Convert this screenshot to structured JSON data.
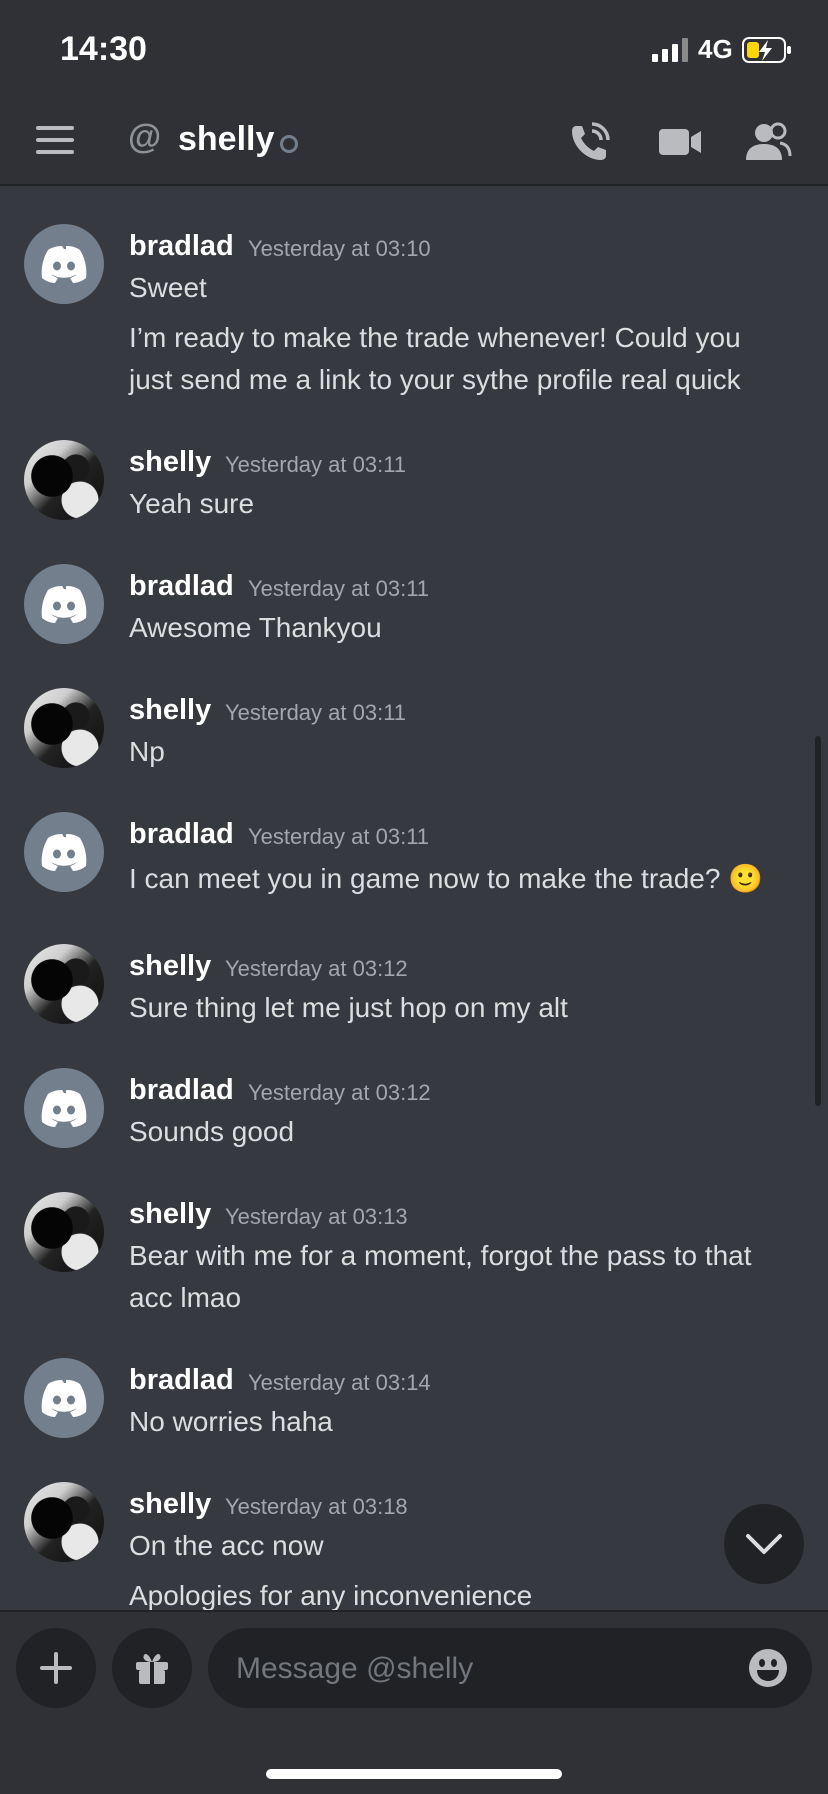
{
  "status_bar": {
    "time": "14:30",
    "network": "4G"
  },
  "header": {
    "at_symbol": "@",
    "title": "shelly"
  },
  "messages": [
    {
      "author": "bradlad",
      "time": "Yesterday at 03:10",
      "lines": [
        "Sweet",
        "I’m ready to make the trade whenever! Could you",
        "just send me a link to your sythe profile real quick"
      ]
    },
    {
      "author": "shelly",
      "time": "Yesterday at 03:11",
      "lines": [
        "Yeah sure"
      ]
    },
    {
      "author": "bradlad",
      "time": "Yesterday at 03:11",
      "lines": [
        "Awesome Thankyou"
      ]
    },
    {
      "author": "shelly",
      "time": "Yesterday at 03:11",
      "lines": [
        "Np"
      ]
    },
    {
      "author": "bradlad",
      "time": "Yesterday at 03:11",
      "lines": [
        "I can meet you in game now to make the trade? 🙂"
      ]
    },
    {
      "author": "shelly",
      "time": "Yesterday at 03:12",
      "lines": [
        "Sure thing let me just hop on my alt"
      ]
    },
    {
      "author": "bradlad",
      "time": "Yesterday at 03:12",
      "lines": [
        "Sounds good"
      ]
    },
    {
      "author": "shelly",
      "time": "Yesterday at 03:13",
      "lines": [
        "Bear with me for a moment, forgot the pass to that",
        "acc lmao"
      ]
    },
    {
      "author": "bradlad",
      "time": "Yesterday at 03:14",
      "lines": [
        "No worries haha"
      ]
    },
    {
      "author": "shelly",
      "time": "Yesterday at 03:18",
      "lines": [
        "On the acc now",
        "Apologies for any inconvenience"
      ]
    }
  ],
  "composer": {
    "placeholder": "Message @shelly"
  },
  "colors": {
    "background": "#36393f",
    "header": "#2f3136",
    "username": "#ffffff",
    "timestamp": "#a3a6aa",
    "avatar_default": "#747f8d"
  }
}
